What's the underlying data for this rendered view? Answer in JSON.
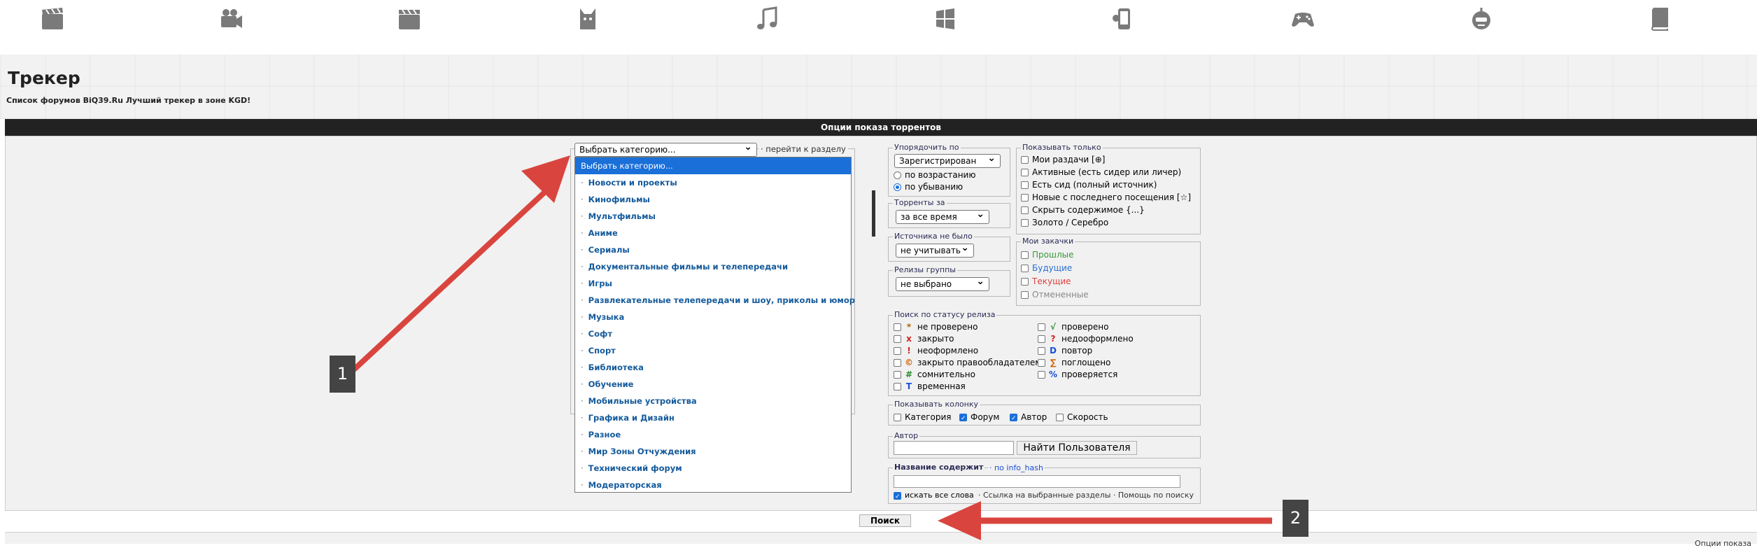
{
  "nav": {
    "icons": [
      "films-icon",
      "video-camera-icon",
      "clapperboard-icon",
      "cartoon-cat-icon",
      "music-note-icon",
      "windows-icon",
      "mobile-app-icon",
      "gamepad-icon",
      "robot-face-icon",
      "book-icon"
    ]
  },
  "page": {
    "title": "Трекер",
    "subtitle": "Список форумов BiQ39.Ru Лучший трекер в зоне KGD!"
  },
  "options": {
    "header": "Опции показа торрентов",
    "category_select": "Выбрать категорию...",
    "goto_section": "· перейти к разделу",
    "categories": [
      "Выбрать категорию...",
      "Новости и проекты",
      "Кинофильмы",
      "Мультфильмы",
      "Аниме",
      "Сериалы",
      "Документальные фильмы и телепередачи",
      "Игры",
      "Развлекательные телепередачи и шоу, приколы и юмор",
      "Музыка",
      "Софт",
      "Спорт",
      "Библиотека",
      "Обучение",
      "Мобильные устройства",
      "Графика и Дизайн",
      "Разное",
      "Мир Зоны Отчуждения",
      "Технический форум",
      "Модераторская"
    ],
    "sort": {
      "legend": "Упорядочить по",
      "value": "Зарегистрирован",
      "asc": "по возрастанию",
      "desc": "по убыванию"
    },
    "period": {
      "legend": "Торренты за",
      "value": "за все время"
    },
    "no_source": {
      "legend": "Источника не было",
      "value": "не учитывать"
    },
    "group": {
      "legend": "Релизы группы",
      "value": "не выбрано"
    },
    "show_only": {
      "legend": "Показывать только",
      "items": [
        "Мои раздачи [⊕]",
        "Активные (есть сидер или личер)",
        "Есть сид (полный источник)",
        "Новые с последнего посещения [☆]",
        "Скрыть содержимое {...}",
        "Золото / Серебро"
      ]
    },
    "my_downloads": {
      "legend": "Мои закачки",
      "items": [
        "Прошлые",
        "Будущие",
        "Текущие",
        "Отмененные"
      ],
      "colors": [
        "#3a9a3a",
        "#2a6fd0",
        "#e04040",
        "#888888"
      ]
    },
    "status": {
      "legend": "Поиск по статусу релиза",
      "left": [
        {
          "mark": "*",
          "color": "#b06000",
          "label": "не проверено"
        },
        {
          "mark": "x",
          "color": "#d02020",
          "label": "закрыто"
        },
        {
          "mark": "!",
          "color": "#d02020",
          "label": "неоформлено"
        },
        {
          "mark": "©",
          "color": "#d06000",
          "label": "закрыто правообладателем"
        },
        {
          "mark": "#",
          "color": "#2a8a2a",
          "label": "сомнительно"
        },
        {
          "mark": "T",
          "color": "#1a4fd8",
          "label": "временная"
        }
      ],
      "right": [
        {
          "mark": "√",
          "color": "#2a8a2a",
          "label": "проверено"
        },
        {
          "mark": "?",
          "color": "#d02020",
          "label": "недооформлено"
        },
        {
          "mark": "D",
          "color": "#1a4fd8",
          "label": "повтор"
        },
        {
          "mark": "∑",
          "color": "#d06000",
          "label": "поглощено"
        },
        {
          "mark": "%",
          "color": "#1a4fd8",
          "label": "проверяется"
        }
      ]
    },
    "columns": {
      "legend": "Показывать колонку",
      "items": [
        {
          "label": "Категория",
          "checked": false
        },
        {
          "label": "Форум",
          "checked": true
        },
        {
          "label": "Автор",
          "checked": true
        },
        {
          "label": "Скорость",
          "checked": false
        }
      ]
    },
    "author": {
      "legend": "Автор",
      "find_button": "Найти Пользователя"
    },
    "title_search": {
      "legend_bold": "Название содержит",
      "legend_link": "· по info_hash",
      "all_words": "искать все слова",
      "links": "· Ссылка на выбранные разделы · Помощь по поиску"
    },
    "search_button": "Поиск"
  },
  "footer": {
    "right_text": "Опции показа"
  },
  "annotations": {
    "badge1": "1",
    "badge2": "2",
    "arrow_color": "#d9453e"
  }
}
